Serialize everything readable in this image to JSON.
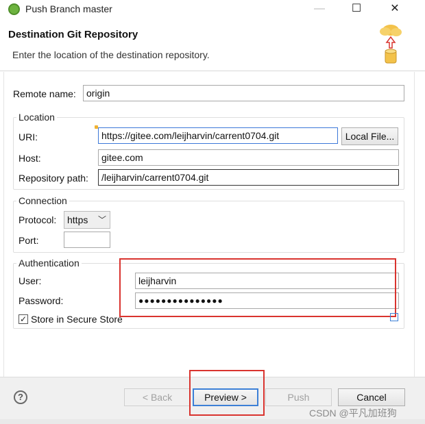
{
  "window": {
    "title": "Push Branch master",
    "minimize": "—",
    "maximize": "☐",
    "close": "✕"
  },
  "header": {
    "title": "Destination Git Repository",
    "description": "Enter the location of the destination repository."
  },
  "remote": {
    "label": "Remote name:",
    "value": "origin"
  },
  "location": {
    "title": "Location",
    "uri_label": "URI:",
    "uri_value": "https://gitee.com/leijharvin/carrent0704.git",
    "local_file_button": "Local File...",
    "host_label": "Host:",
    "host_value": "gitee.com",
    "repo_path_label": "Repository path:",
    "repo_path_value": "/leijharvin/carrent0704.git"
  },
  "connection": {
    "title": "Connection",
    "protocol_label": "Protocol:",
    "protocol_value": "https",
    "port_label": "Port:",
    "port_value": ""
  },
  "authentication": {
    "title": "Authentication",
    "user_label": "User:",
    "user_value": "leijharvin",
    "password_label": "Password:",
    "password_value": "●●●●●●●●●●●●●●●",
    "store_label": "Store in Secure Store",
    "store_checked": "✓"
  },
  "footer": {
    "help": "?",
    "back": "< Back",
    "preview": "Preview >",
    "push": "Push",
    "cancel": "Cancel"
  },
  "watermark": "CSDN @平凡加班狗",
  "colors": {
    "highlight_red": "#d9332e",
    "focus_blue": "#3c7fd6"
  }
}
